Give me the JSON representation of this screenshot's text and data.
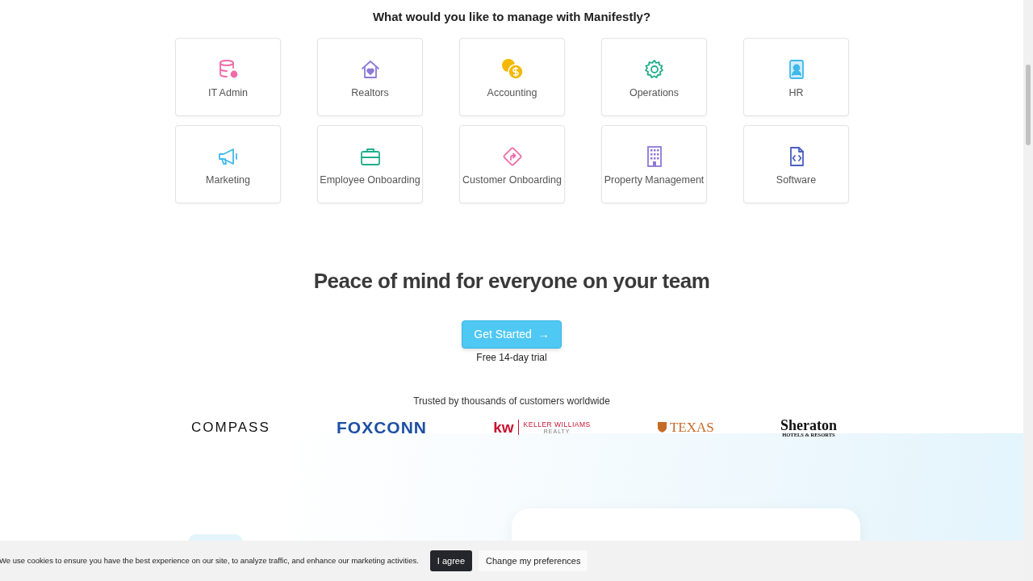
{
  "heading": "What would you like to manage with Manifestly?",
  "categories": [
    {
      "label": "IT Admin",
      "color": "#f06ba8"
    },
    {
      "label": "Realtors",
      "color": "#8c7bd6"
    },
    {
      "label": "Accounting",
      "color": "#f5b800"
    },
    {
      "label": "Operations",
      "color": "#1fae8c"
    },
    {
      "label": "HR",
      "color": "#3fb9ea"
    },
    {
      "label": "Marketing",
      "color": "#3fb9ea"
    },
    {
      "label": "Employee Onboarding",
      "color": "#1fae8c"
    },
    {
      "label": "Customer Onboarding",
      "color": "#f06ba8"
    },
    {
      "label": "Property Management",
      "color": "#8c7bd6"
    },
    {
      "label": "Software",
      "color": "#4a5fc1"
    }
  ],
  "hero": {
    "title": "Peace of mind for everyone on your team",
    "button": "Get Started",
    "arrow": "→",
    "note": "Free 14-day trial"
  },
  "trusted": {
    "caption": "Trusted by thousands of customers worldwide",
    "logos": [
      {
        "kind": "compass",
        "text": "COMPASS"
      },
      {
        "kind": "foxconn",
        "text": "FOXCONN"
      },
      {
        "kind": "kw",
        "text": "kw",
        "sub": "KELLER WILLIAMS",
        "sub2": "REALTY"
      },
      {
        "kind": "texas",
        "text": "TEXAS"
      },
      {
        "kind": "sheraton",
        "text": "Sheraton",
        "sub": "HOTELS & RESORTS"
      }
    ]
  },
  "cookie_bar": {
    "message": "We use cookies to ensure you have the best experience on our site, to analyze traffic, and enhance our marketing activities.",
    "agree": "I agree",
    "preferences": "Change my preferences"
  }
}
